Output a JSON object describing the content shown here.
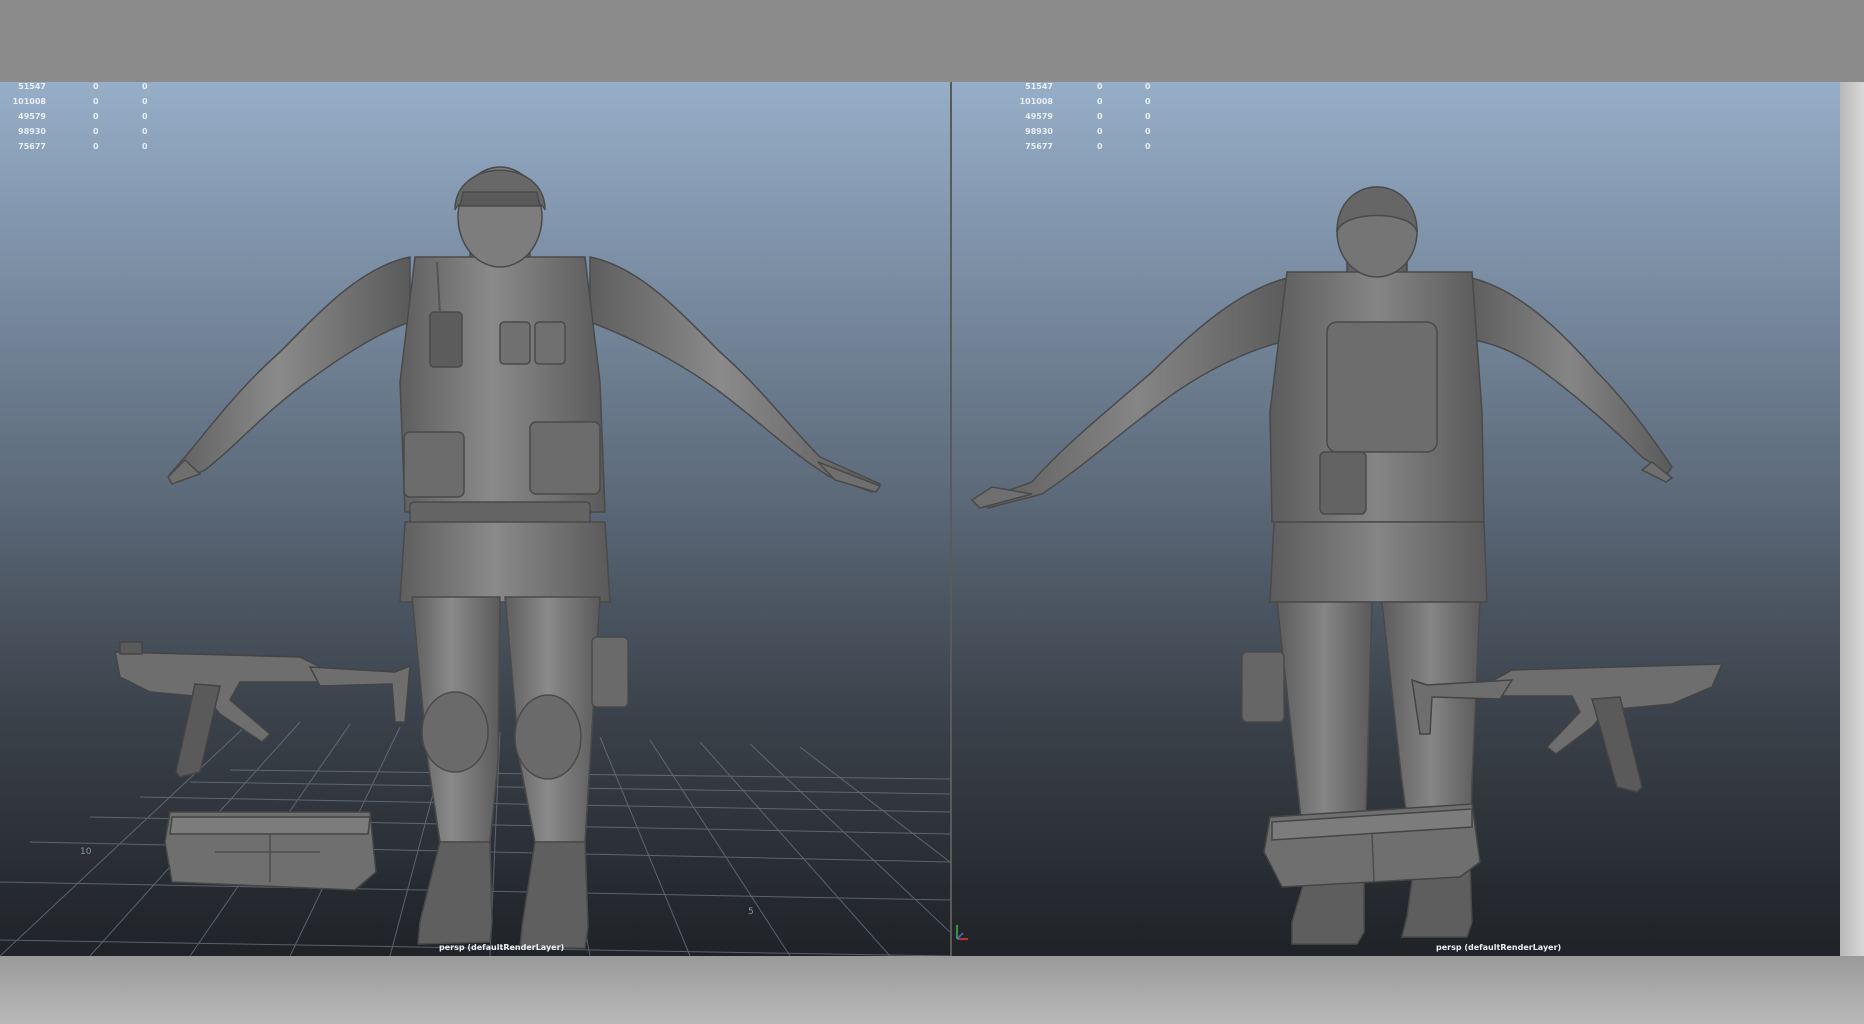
{
  "viewports": [
    {
      "hud": [
        [
          "51547",
          "0",
          "0"
        ],
        [
          "101008",
          "0",
          "0"
        ],
        [
          "49579",
          "0",
          "0"
        ],
        [
          "98930",
          "0",
          "0"
        ],
        [
          "75677",
          "0",
          "0"
        ]
      ],
      "label": "persp (defaultRenderLayer)",
      "grid_numbers": [
        "10",
        "5"
      ]
    },
    {
      "hud": [
        [
          "51547",
          "0",
          "0"
        ],
        [
          "101008",
          "0",
          "0"
        ],
        [
          "49579",
          "0",
          "0"
        ],
        [
          "98930",
          "0",
          "0"
        ],
        [
          "75677",
          "0",
          "0"
        ]
      ],
      "label": "persp (defaultRenderLayer)"
    }
  ],
  "colors": {
    "sky_top": "#97aec8",
    "floor": "#1f2226",
    "model_gray": "#7a7a7a",
    "grid_line": "#6e7680"
  },
  "icons": [
    "axis-gizmo-icon"
  ]
}
